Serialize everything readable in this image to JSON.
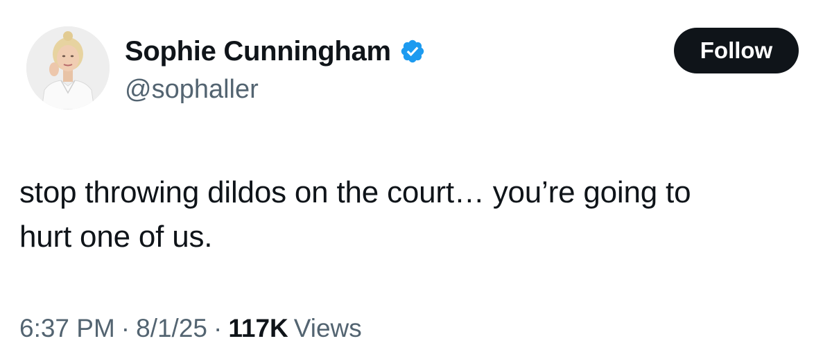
{
  "user": {
    "display_name": "Sophie Cunningham",
    "handle": "@sophaller",
    "verified": true,
    "verified_icon": "verified-badge-icon",
    "verified_color": "#1d9bf0"
  },
  "actions": {
    "follow_label": "Follow"
  },
  "tweet": {
    "text": "stop throwing dildos on the court… you’re going to\nhurt one of us."
  },
  "meta": {
    "time": "6:37 PM",
    "separator": "·",
    "date": "8/1/25",
    "views_count": "117K",
    "views_label": "Views"
  },
  "colors": {
    "text_primary": "#0f1419",
    "text_secondary": "#536471",
    "button_bg": "#0f1419",
    "button_text": "#ffffff",
    "background": "#ffffff"
  }
}
